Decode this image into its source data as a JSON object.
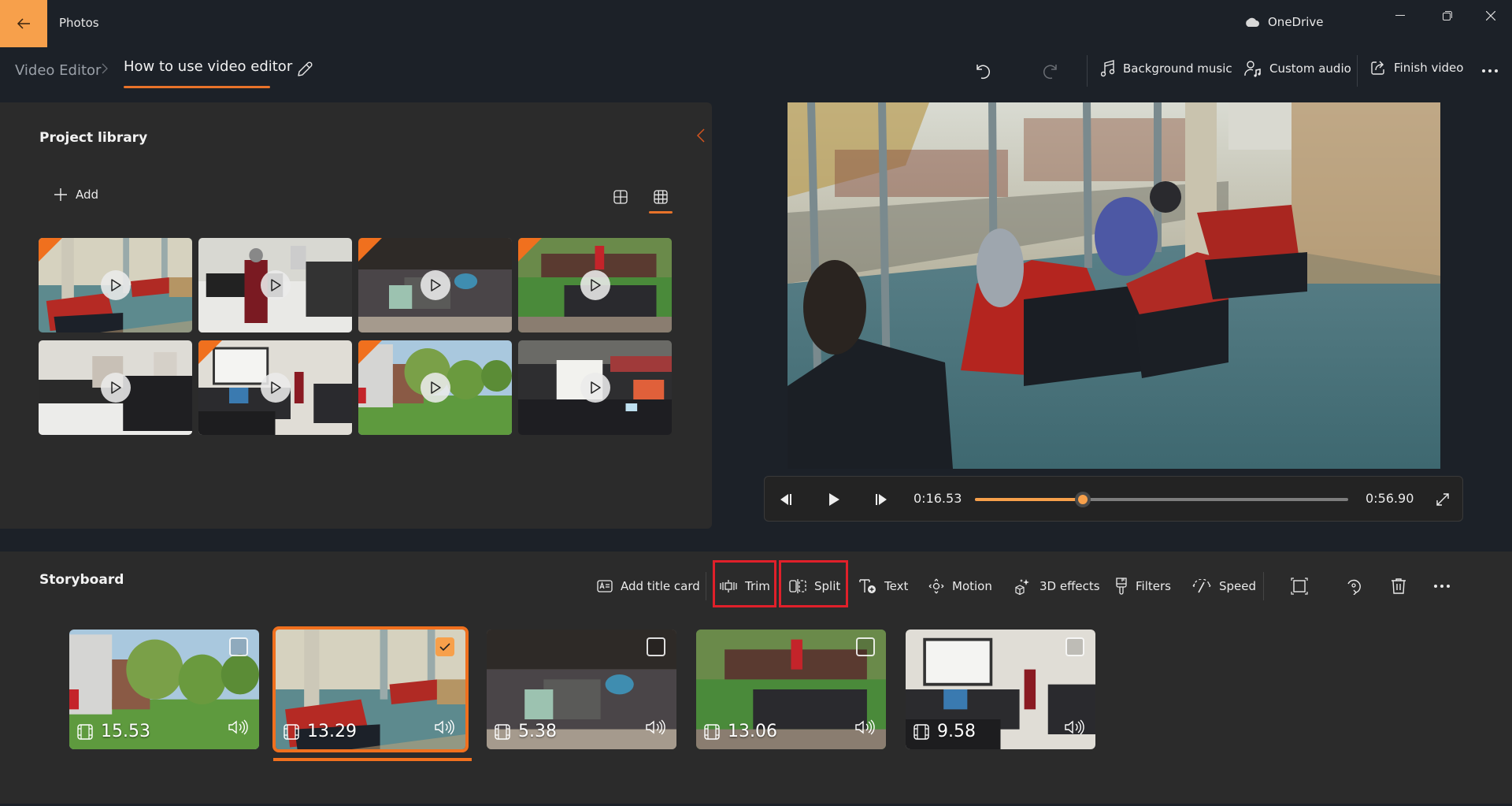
{
  "app": {
    "title": "Photos",
    "onedrive_label": "OneDrive",
    "window_controls": [
      "minimize",
      "restore",
      "close"
    ]
  },
  "breadcrumb": {
    "root": "Video Editor",
    "separator": ">",
    "current": "How to use video editor"
  },
  "header_actions": {
    "undo": "undo-icon",
    "redo": "redo-icon",
    "background_music": "Background music",
    "custom_audio": "Custom audio",
    "finish_video": "Finish video",
    "more": "..."
  },
  "library": {
    "title": "Project library",
    "add_label": "Add",
    "view_modes": [
      "large-grid",
      "small-grid"
    ],
    "active_view": "small-grid",
    "items": [
      {
        "scene": "lounge",
        "in_storyboard": true
      },
      {
        "scene": "lab-girl",
        "in_storyboard": false
      },
      {
        "scene": "patio-table",
        "in_storyboard": true
      },
      {
        "scene": "lawn-tables",
        "in_storyboard": true
      },
      {
        "scene": "lab-empty",
        "in_storyboard": false
      },
      {
        "scene": "classroom",
        "in_storyboard": true
      },
      {
        "scene": "campus-lawn",
        "in_storyboard": true
      },
      {
        "scene": "atrium-flags",
        "in_storyboard": false
      }
    ]
  },
  "player": {
    "current_time": "0:16.53",
    "total_time": "0:56.90",
    "progress": 0.29
  },
  "storyboard": {
    "title": "Storyboard",
    "tools": {
      "add_title_card": "Add title card",
      "trim": "Trim",
      "split": "Split",
      "text": "Text",
      "motion": "Motion",
      "effects_3d": "3D effects",
      "filters": "Filters",
      "speed": "Speed"
    },
    "highlighted_tools": [
      "Trim",
      "Split"
    ],
    "clips": [
      {
        "duration": "15.53",
        "scene": "campus-lawn",
        "selected": false
      },
      {
        "duration": "13.29",
        "scene": "lounge",
        "selected": true
      },
      {
        "duration": "5.38",
        "scene": "patio-table",
        "selected": false
      },
      {
        "duration": "13.06",
        "scene": "lawn-tables",
        "selected": false
      },
      {
        "duration": "9.58",
        "scene": "classroom",
        "selected": false
      }
    ]
  },
  "colors": {
    "accent": "#f0701e",
    "accent_light": "#f7a04b",
    "highlight_box": "#e0202a",
    "title_bar_bg": "#1c2128",
    "panel_bg": "#2b2b2b"
  }
}
